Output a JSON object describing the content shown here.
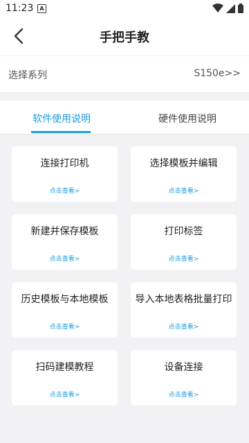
{
  "status": {
    "time": "11:23",
    "notif": "A"
  },
  "appbar": {
    "title": "手把手教"
  },
  "series": {
    "label": "选择系列",
    "value": "S150e>>"
  },
  "tabs": [
    {
      "label": "软件使用说明"
    },
    {
      "label": "硬件使用说明"
    }
  ],
  "cards": [
    {
      "title": "连接打印机",
      "link": "点击查看>"
    },
    {
      "title": "选择模板并编辑",
      "link": "点击查看>"
    },
    {
      "title": "新建并保存模板",
      "link": "点击查看>"
    },
    {
      "title": "打印标签",
      "link": "点击查看>"
    },
    {
      "title": "历史模板与本地模板",
      "link": "点击查看>"
    },
    {
      "title": "导入本地表格批量打印",
      "link": "点击查看>"
    },
    {
      "title": "扫码建模教程",
      "link": "点击查看>"
    },
    {
      "title": "设备连接",
      "link": "点击查看>"
    }
  ],
  "colors": {
    "accent": "#1a9ee0",
    "background": "#f2f2f4"
  },
  "icons": {
    "back": "back-arrow-icon",
    "wifi": "wifi-icon",
    "signal": "signal-icon",
    "battery": "battery-icon"
  }
}
